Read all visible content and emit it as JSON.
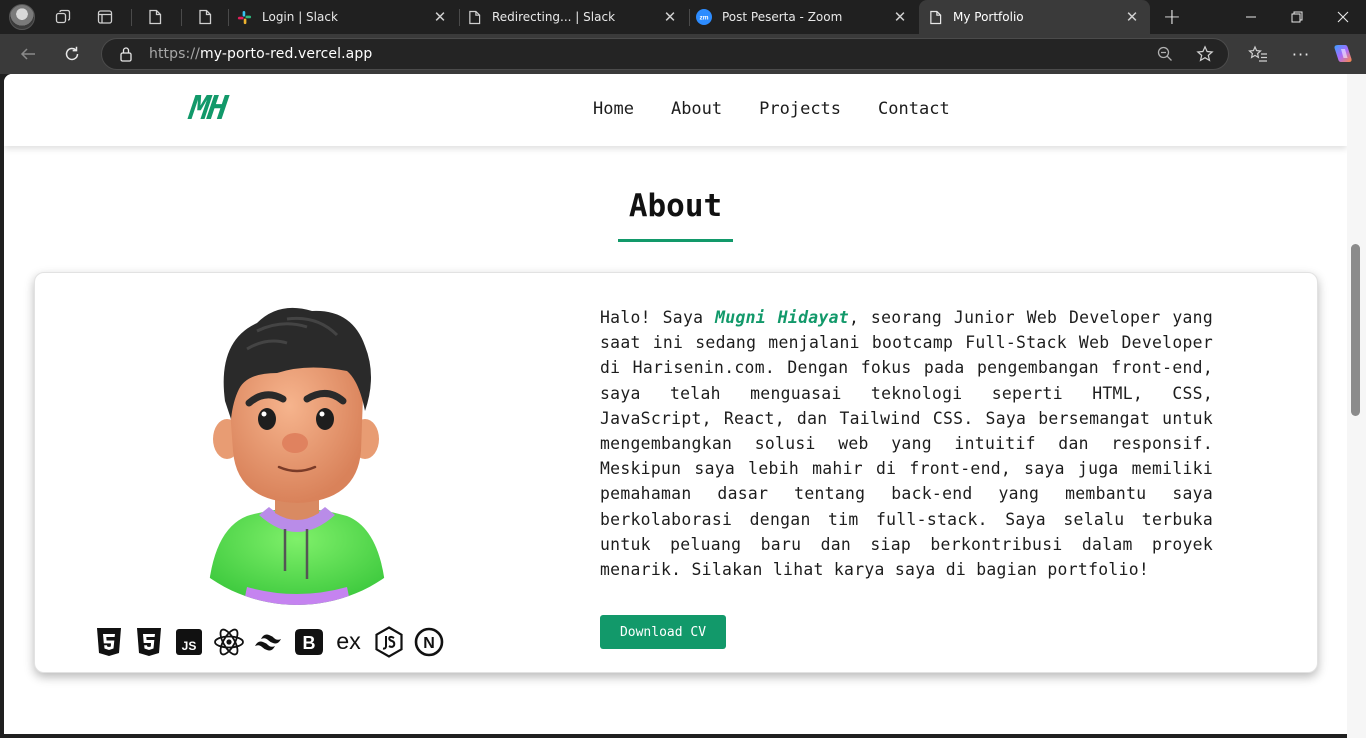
{
  "browser": {
    "tabs": [
      {
        "title": "Login | Slack",
        "favicon": "slack-icon"
      },
      {
        "title": "Redirecting... | Slack",
        "favicon": "page-icon"
      },
      {
        "title": "Post Peserta - Zoom",
        "favicon": "zoom-icon"
      },
      {
        "title": "My Portfolio",
        "favicon": "page-icon",
        "active": true
      }
    ],
    "url_prefix": "https://",
    "url_host": "my-porto-red.vercel.app"
  },
  "site": {
    "logo": "MH",
    "nav": [
      "Home",
      "About",
      "Projects",
      "Contact"
    ],
    "accent": "#12996a"
  },
  "about": {
    "title": "About",
    "bio_before": "Halo! Saya ",
    "name": "Mugni Hidayat",
    "bio_after": ", seorang Junior Web Developer yang saat ini sedang menjalani bootcamp Full-Stack Web Developer di Harisenin.com. Dengan fokus pada pengembangan front-end, saya telah menguasai teknologi seperti HTML, CSS, JavaScript, React, dan Tailwind CSS. Saya bersemangat untuk mengembangkan solusi web yang intuitif dan responsif. Meskipun saya lebih mahir di front-end, saya juga memiliki pemahaman dasar tentang back-end yang membantu saya berkolaborasi dengan tim full-stack. Saya selalu terbuka untuk peluang baru dan siap berkontribusi dalam proyek menarik. Silakan lihat karya saya di bagian portfolio!",
    "button": "Download CV",
    "tech_icons": [
      "html5-icon",
      "css3-icon",
      "javascript-icon",
      "react-icon",
      "tailwind-icon",
      "bootstrap-icon",
      "express-icon",
      "nodejs-icon",
      "nextjs-icon"
    ],
    "tech_text": {
      "js": "JS",
      "express": "ex",
      "bootstrap": "B",
      "next": "N"
    }
  }
}
